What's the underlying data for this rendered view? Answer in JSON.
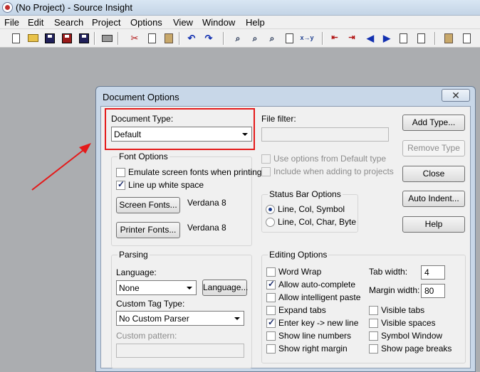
{
  "app": {
    "title": "(No Project) - Source Insight",
    "menu": [
      "File",
      "Edit",
      "Search",
      "Project",
      "Options",
      "View",
      "Window",
      "Help"
    ]
  },
  "toolbar": {
    "icons": [
      "new-file-icon",
      "open-folder-icon",
      "save-icon",
      "save-all-icon",
      "close-file-icon",
      "print-icon",
      "cut-icon",
      "copy-icon",
      "paste-icon",
      "undo-icon",
      "redo-icon",
      "search-icon",
      "search-files-icon",
      "search-project-icon",
      "lookup-references-icon",
      "replace-icon",
      "jump-prev-icon",
      "jump-next-icon",
      "go-back-icon",
      "go-forward-icon",
      "bookmark-icon",
      "bookmark-list-icon",
      "project-window-icon",
      "symbol-window-icon"
    ],
    "replace_label": "x→y"
  },
  "annotation": {
    "color": "#e41a1a"
  },
  "dialog": {
    "title": "Document Options",
    "close_glyph": "✕",
    "document_type": {
      "label": "Document Type:",
      "value": "Default"
    },
    "file_filter": {
      "label": "File filter:",
      "value": ""
    },
    "use_default_options": {
      "label": "Use options from Default type",
      "checked": false,
      "enabled": false
    },
    "include_adding_projects": {
      "label": "Include when adding to projects",
      "checked": false,
      "enabled": false
    },
    "buttons": {
      "add_type": "Add Type...",
      "remove_type": "Remove Type",
      "close": "Close",
      "auto_indent": "Auto Indent...",
      "help": "Help"
    },
    "font_options": {
      "title": "Font Options",
      "emulate_screen_fonts": {
        "label": "Emulate screen fonts when printing",
        "checked": false
      },
      "line_up_white_space": {
        "label": "Line up white space",
        "checked": true
      },
      "screen_fonts_button": "Screen Fonts...",
      "screen_font_value": "Verdana 8",
      "printer_fonts_button": "Printer Fonts...",
      "printer_font_value": "Verdana 8"
    },
    "status_bar_options": {
      "title": "Status Bar Options",
      "options": [
        {
          "label": "Line, Col, Symbol",
          "selected": true
        },
        {
          "label": "Line, Col, Char, Byte",
          "selected": false
        }
      ]
    },
    "parsing": {
      "title": "Parsing",
      "language_label": "Language:",
      "language_value": "None",
      "language_button": "Language...",
      "custom_tag_label": "Custom Tag Type:",
      "custom_tag_value": "No Custom Parser",
      "custom_pattern_label": "Custom pattern:",
      "custom_pattern_value": ""
    },
    "editing_options": {
      "title": "Editing Options",
      "left_checks": [
        {
          "label": "Word Wrap",
          "checked": false
        },
        {
          "label": "Allow auto-complete",
          "checked": true
        },
        {
          "label": "Allow intelligent paste",
          "checked": false
        },
        {
          "label": "Expand tabs",
          "checked": false
        },
        {
          "label": "Enter key -> new line",
          "checked": true
        },
        {
          "label": "Show line numbers",
          "checked": false
        },
        {
          "label": "Show right margin",
          "checked": false
        }
      ],
      "tab_width_label": "Tab width:",
      "tab_width_value": "4",
      "margin_width_label": "Margin width:",
      "margin_width_value": "80",
      "right_checks": [
        {
          "label": "Visible tabs",
          "checked": false
        },
        {
          "label": "Visible spaces",
          "checked": false
        },
        {
          "label": "Symbol Window",
          "checked": false
        },
        {
          "label": "Show page breaks",
          "checked": false
        }
      ]
    }
  }
}
